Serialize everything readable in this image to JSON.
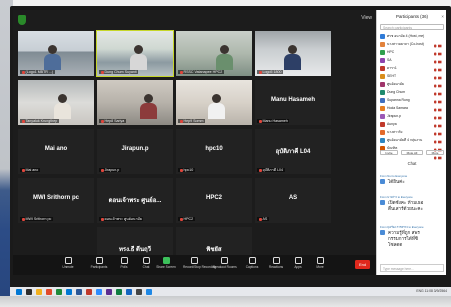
{
  "window": {
    "view_label": "View"
  },
  "tiles": [
    {
      "label": "(Logo1 MBTR ...)",
      "kind": "photo"
    },
    {
      "label": "Dung Chum Suyanti",
      "kind": "photo",
      "active": true
    },
    {
      "label": "RSSC Vatanapee HPC2",
      "kind": "photo"
    },
    {
      "label": "Logo5 1800",
      "kind": "photo"
    },
    {
      "label": "Tanyaluk Krungthep",
      "kind": "photo"
    },
    {
      "label": "Hep8 Sariya",
      "kind": "photo"
    },
    {
      "label": "Hep9 Somm",
      "kind": "photo"
    },
    {
      "label": "Manu Hasameh",
      "kind": "name",
      "big": "Manu Hasameh"
    },
    {
      "label": "Mai ano",
      "kind": "name",
      "big": "Mai ano"
    },
    {
      "label": "Jirapun.p",
      "kind": "name",
      "big": "Jirapun.p"
    },
    {
      "label": "hpc10",
      "kind": "name",
      "big": "hpc10"
    },
    {
      "label": "อุบัติภาคี L04",
      "kind": "name",
      "big": "อุบัติภาคี L04"
    },
    {
      "label": "MWI Srithorn pc",
      "kind": "name",
      "big": "MWI Srithorn pc"
    },
    {
      "label": "ดอนเจ้าพระ ศูนย์อนามัย",
      "kind": "name",
      "big": "ดอนเจ้าพระ ศูนย์อ..."
    },
    {
      "label": "HPC2",
      "kind": "name",
      "big": "HPC2"
    },
    {
      "label": "AS",
      "kind": "name",
      "big": "AS"
    },
    {
      "label": "ทรงวิ ดีนฤวิ",
      "kind": "name",
      "big": "ทรง.ธี ดีนฤวี"
    },
    {
      "label": "พิชยัส",
      "kind": "name",
      "big": "พิชยัส"
    }
  ],
  "toolbar": {
    "buttons": [
      {
        "label": "Unmute",
        "icon": "mic-icon"
      },
      {
        "label": "Participants",
        "icon": "participants-icon"
      },
      {
        "label": "Polls",
        "icon": "polls-icon"
      },
      {
        "label": "Chat",
        "icon": "chat-icon"
      },
      {
        "label": "Share Screen",
        "icon": "share-icon"
      },
      {
        "label": "Record/Stop Recording",
        "icon": "record-icon"
      },
      {
        "label": "Breakout Rooms",
        "icon": "breakout-icon"
      },
      {
        "label": "Captions",
        "icon": "captions-icon"
      },
      {
        "label": "Reactions",
        "icon": "reactions-icon"
      },
      {
        "label": "Apps",
        "icon": "apps-icon"
      },
      {
        "label": "More",
        "icon": "more-icon"
      }
    ],
    "end_label": "End",
    "accent": "#0e72ed",
    "end_color": "#e0281c"
  },
  "panel": {
    "title": "Participants (36)",
    "search_placeholder": "Search participants",
    "participants": [
      {
        "name": "ศรช อนามัย 4 (Host, me)",
        "color": "#2f7bd8"
      },
      {
        "name": "นางสาวมยาลา (Co-host)",
        "color": "#e2823b"
      },
      {
        "name": "HPC",
        "color": "#2fa04e"
      },
      {
        "name": "SA",
        "color": "#8e44ad"
      },
      {
        "name": "ดารา1",
        "color": "#c0392b"
      },
      {
        "name": "SEHT",
        "color": "#d98d1b"
      },
      {
        "name": "ศูนย์อนามัย",
        "color": "#a0356b"
      },
      {
        "name": "Dung Chum",
        "color": "#1e8a6e"
      },
      {
        "name": "Supanna Rung",
        "color": "#3f6fbf"
      },
      {
        "name": "Hoda Samara",
        "color": "#e67e22"
      },
      {
        "name": "Jirapun.p",
        "color": "#9b59b6"
      },
      {
        "name": "Aunya",
        "color": "#c0392b"
      },
      {
        "name": "นางสาวกิ่ง",
        "color": "#e26a2c"
      },
      {
        "name": "ศูนย์อนามัยที่ 4 กลุ่มงาน",
        "color": "#2e86c1"
      },
      {
        "name": "บัณฑิต",
        "color": "#d35400"
      }
    ],
    "invite_label": "Invite",
    "mute_label": "Mute All",
    "more_label": "More"
  },
  "chat": {
    "title": "Chat",
    "messages": [
      {
        "meta": "From Nui to Everyone",
        "text": "ได้ยินค่ะ"
      },
      {
        "meta": "From นางสาว to Everyone",
        "text": "เปิดซังคะ ห้ามเธอ\nตื่นเสาร์ด้วยนะคะ"
      },
      {
        "meta": "From ยุ่งเรือง การตรวจ to Everyone",
        "text": "ความรู้ที่ถูก สพร\nกรรมการได้ที่ซิ\nโซลดด"
      }
    ],
    "input_placeholder": "Type message here..."
  },
  "taskbar": {
    "tray_text": "ENG  11:08  3/9/2564"
  }
}
